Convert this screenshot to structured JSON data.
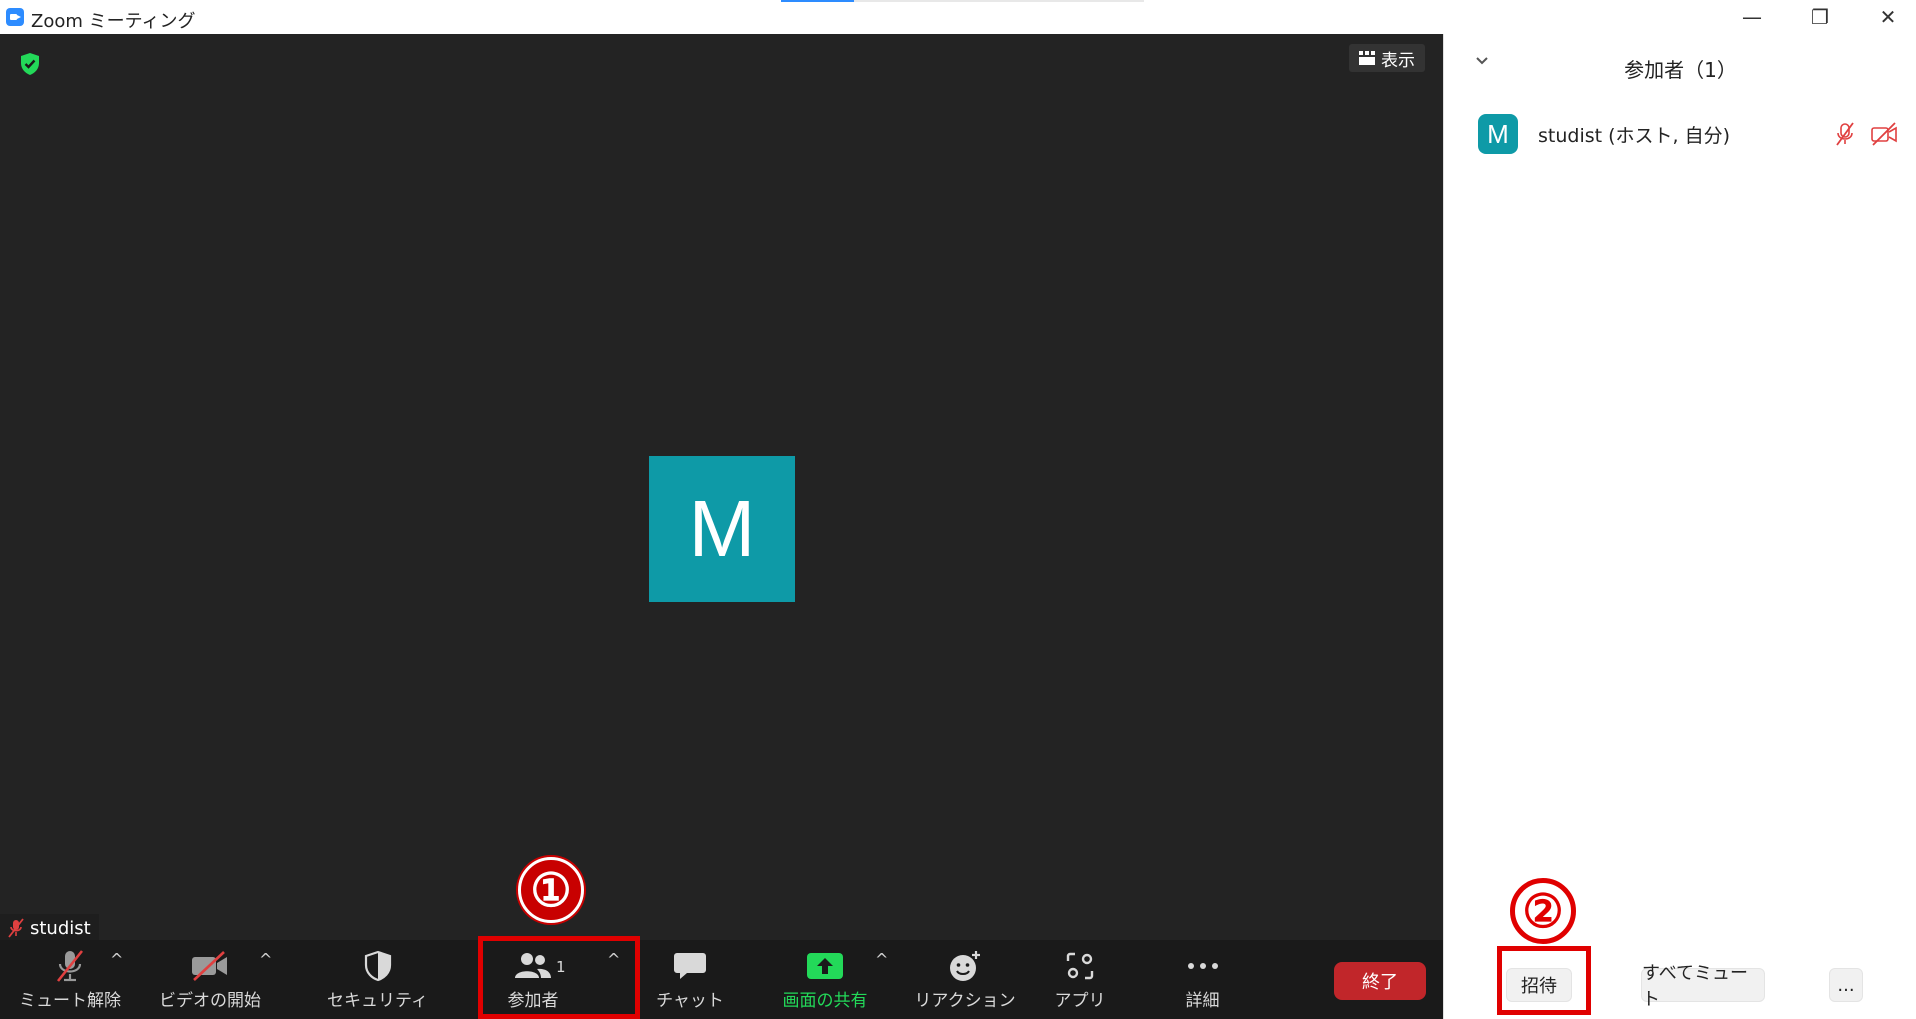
{
  "window": {
    "title": "Zoom ミーティング",
    "minimize_glyph": "—",
    "restore_glyph": "❐",
    "close_glyph": "✕"
  },
  "video": {
    "view_label": "表示",
    "avatar_initial": "M",
    "name_tag": "studist"
  },
  "toolbar": {
    "unmute_label": "ミュート解除",
    "start_video_label": "ビデオの開始",
    "security_label": "セキュリティ",
    "participants_label": "参加者",
    "participants_count": "1",
    "chat_label": "チャット",
    "share_screen_label": "画面の共有",
    "reactions_label": "リアクション",
    "apps_label": "アプリ",
    "more_label": "詳細",
    "end_label": "終了",
    "caret": "^"
  },
  "participants_panel": {
    "title": "参加者（1）",
    "participants": [
      {
        "initial": "M",
        "name": "studist (ホスト, 自分)"
      }
    ],
    "invite_label": "招待",
    "mute_all_label": "すべてミュート",
    "more_label": "..."
  },
  "annotations": {
    "step1": "①",
    "step2": "②"
  },
  "colors": {
    "video_bg": "#232323",
    "toolbar_bg": "#1a1a1a",
    "avatar": "#0e9aa7",
    "share_green": "#23d959",
    "end_red": "#c1262a",
    "highlight_red": "#e00000"
  }
}
